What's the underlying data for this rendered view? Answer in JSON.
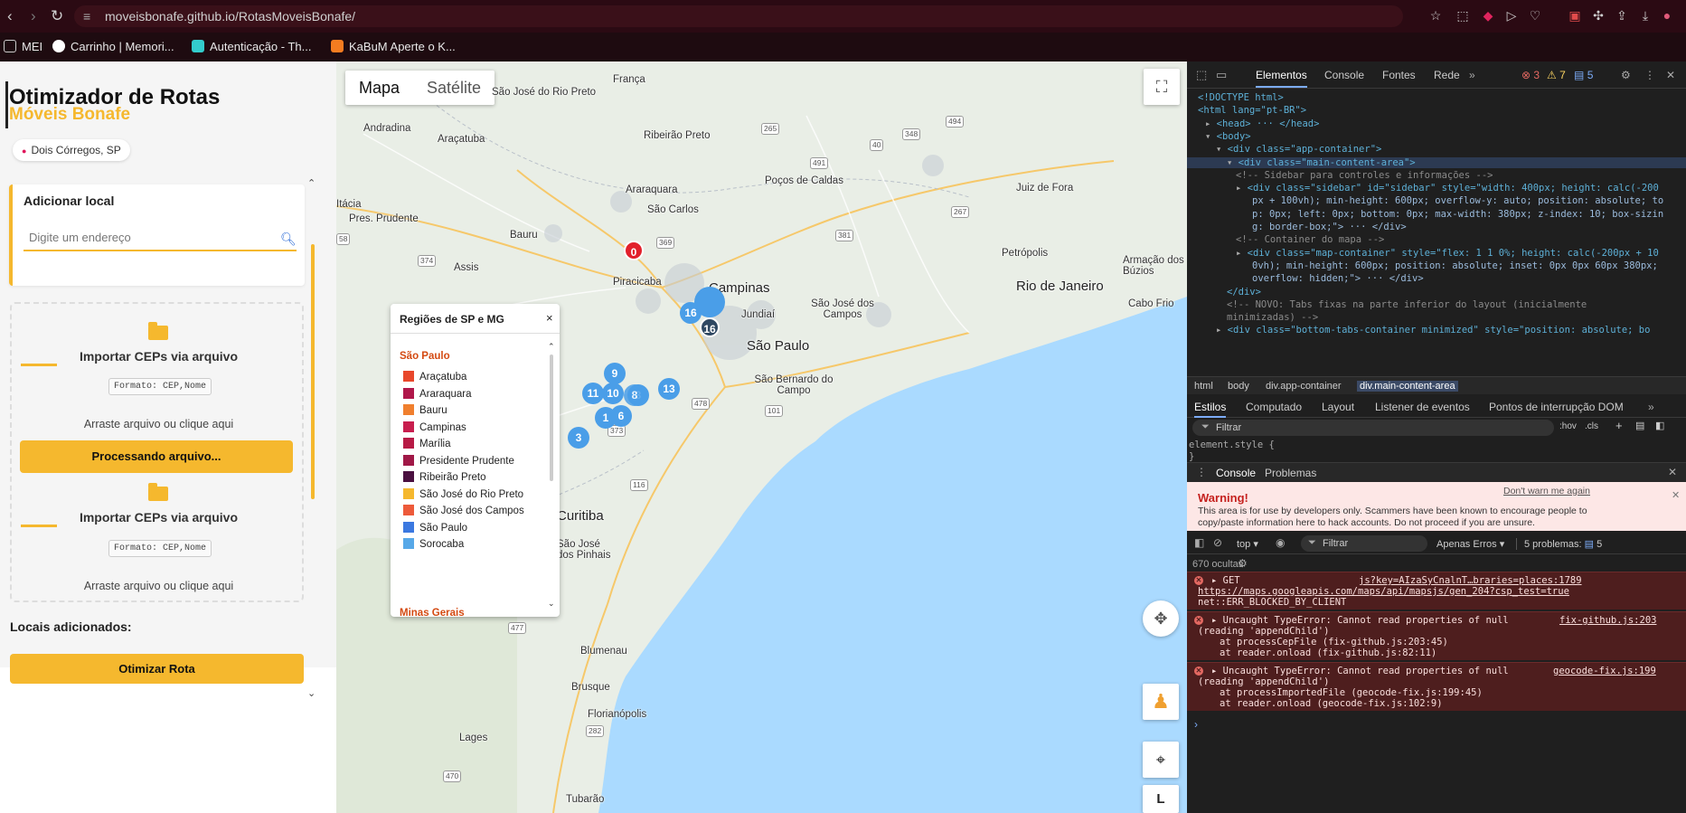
{
  "browser": {
    "url": "moveisbonafe.github.io/RotasMoveisBonafe/",
    "bookmarks": [
      "MEI",
      "Carrinho | Memori...",
      "Autenticação - Th...",
      "KaBuM Aperte o K..."
    ]
  },
  "sidebar": {
    "title": "Otimizador de Rotas",
    "subtitle": "Móveis Bonafe",
    "location": "Dois Córregos, SP",
    "add_card": {
      "heading": "Adicionar local",
      "input_placeholder": "Digite um endereço"
    },
    "import": [
      {
        "title": "Importar CEPs via arquivo",
        "format": "Formato: CEP,Nome",
        "drag": "Arraste arquivo ou clique aqui"
      },
      {
        "title": "Importar CEPs via arquivo",
        "format": "Formato: CEP,Nome",
        "drag": "Arraste arquivo ou clique aqui"
      }
    ],
    "processing_label": "Processando arquivo...",
    "locais_label": "Locais adicionados:",
    "optimize_label": "Otimizar Rota"
  },
  "map": {
    "tabs": [
      "Mapa",
      "Satélite"
    ],
    "zoom_in": "+",
    "layer_label": "L",
    "cities": [
      "França",
      "São José do Rio Preto",
      "Andradina",
      "Araçatuba",
      "Ribeirão Preto",
      "Poços de Caldas",
      "Araraquara",
      "São Carlos",
      "Juiz de Fora",
      "Pres. Prudente",
      "Bauru",
      "Assis",
      "Piracicaba",
      "Campinas",
      "Jundiaí",
      "São José dos Campos",
      "Petrópolis",
      "Rio de Janeiro",
      "Armação dos Búzios",
      "Cabo Frio",
      "São Paulo",
      "São Bernardo do Campo",
      "Curitiba",
      "São José dos Pinhais",
      "Blumenau",
      "Brusque",
      "Florianópolis",
      "Lages",
      "Tubarão",
      "Itácia"
    ],
    "roads": [
      "369",
      "265",
      "491",
      "494",
      "374",
      "267",
      "381",
      "348",
      "40",
      "101",
      "116",
      "478",
      "282",
      "470",
      "477",
      "373",
      "58"
    ],
    "clusters": [
      "9",
      "11",
      "10",
      "3",
      "8",
      "13",
      "1",
      "6",
      "3",
      "16",
      "16"
    ],
    "origin_marker": "0",
    "legend": {
      "title": "Regiões de SP e MG",
      "close": "×",
      "group1": "São Paulo",
      "items": [
        {
          "label": "Araçatuba",
          "color": "#e8472b"
        },
        {
          "label": "Araraquara",
          "color": "#b0174a"
        },
        {
          "label": "Bauru",
          "color": "#f07f2e"
        },
        {
          "label": "Campinas",
          "color": "#c81e4e"
        },
        {
          "label": "Marília",
          "color": "#b71a45"
        },
        {
          "label": "Presidente Prudente",
          "color": "#a01847"
        },
        {
          "label": "Ribeirão Preto",
          "color": "#4a1040"
        },
        {
          "label": "São José do Rio Preto",
          "color": "#f5b82e"
        },
        {
          "label": "São José dos Campos",
          "color": "#ed5a3a"
        },
        {
          "label": "São Paulo",
          "color": "#3b78e0"
        },
        {
          "label": "Sorocaba",
          "color": "#57a8e8"
        }
      ],
      "group2": "Minas Gerais"
    }
  },
  "devtools": {
    "tabs": [
      "Elementos",
      "Console",
      "Fontes",
      "Rede"
    ],
    "counts": {
      "errors": "3",
      "warnings": "7",
      "messages": "5"
    },
    "code": [
      "<!DOCTYPE html>",
      "<html lang=\"pt-BR\">",
      "<head> ··· </head>",
      "<body>",
      "<div class=\"app-container\">",
      "<div class=\"main-content-area\">",
      "<!-- Sidebar para controles e informações -->",
      "<div class=\"sidebar\" id=\"sidebar\" style=\"width: 400px; height: calc(-200",
      "px + 100vh); min-height: 600px; overflow-y: auto; position: absolute; to",
      "p: 0px; left: 0px; bottom: 0px; max-width: 380px; z-index: 10; box-sizin",
      "g: border-box;\"> ··· </div>",
      "<!-- Container do mapa -->",
      "<div class=\"map-container\" style=\"flex: 1 1 0%; height: calc(-200px + 10",
      "0vh); min-height: 600px; position: absolute; inset: 0px 0px 60px 380px;",
      "overflow: hidden;\"> ··· </div>",
      "</div>",
      "<!-- NOVO: Tabs fixas na parte inferior do layout (inicialmente",
      "minimizadas) -->",
      "<div class=\"bottom-tabs-container minimized\" style=\"position: absolute; bo"
    ],
    "breadcrumb": [
      "html",
      "body",
      "div.app-container",
      "div.main-content-area"
    ],
    "styles_tabs": [
      "Estilos",
      "Computado",
      "Layout",
      "Listener de eventos",
      "Pontos de interrupção DOM"
    ],
    "filter_placeholder": "Filtrar",
    "style_tools": [
      ":hov",
      ".cls"
    ],
    "element_style": "element.style {",
    "element_style_close": "}",
    "console_tabs": [
      "Console",
      "Problemas"
    ],
    "warning": {
      "dont_warn": "Don't warn me again",
      "title": "Warning!",
      "text1": "This area is for use by developers only. Scammers have been known to encourage people to",
      "text2": "copy/paste information here to hack accounts. Do not proceed if you are unsure."
    },
    "console_toolbar": {
      "context": "top",
      "filter": "Filtrar",
      "levels": "Apenas Erros",
      "problems": "5 problemas:",
      "problems_count": "5",
      "hidden": "670 ocultas"
    },
    "errors": [
      {
        "line1": "GET",
        "source": "js?key=AIzaSyCnalnT…braries=places:1789",
        "line2": "https://maps.googleapis.com/maps/api/mapsjs/gen_204?csp_test=true",
        "line3": "net::ERR_BLOCKED_BY_CLIENT"
      },
      {
        "line1": "Uncaught TypeError: Cannot read properties of null",
        "source": "fix-github.js:203",
        "line2": "(reading 'appendChild')",
        "line3": "at processCepFile (fix-github.js:203:45)",
        "line4": "at reader.onload (fix-github.js:82:11)"
      },
      {
        "line1": "Uncaught TypeError: Cannot read properties of null",
        "source": "geocode-fix.js:199",
        "line2": "(reading 'appendChild')",
        "line3": "at processImportedFile (geocode-fix.js:199:45)",
        "line4": "at reader.onload (geocode-fix.js:102:9)"
      }
    ]
  }
}
